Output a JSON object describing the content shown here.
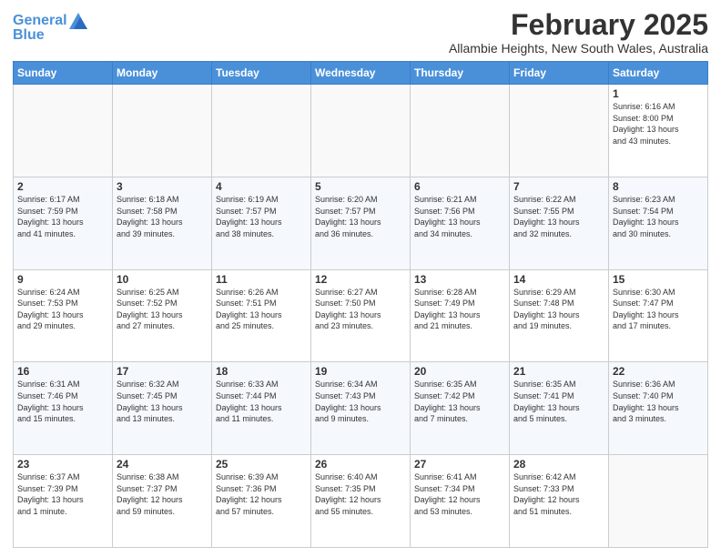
{
  "logo": {
    "line1": "General",
    "line2": "Blue"
  },
  "title": "February 2025",
  "location": "Allambie Heights, New South Wales, Australia",
  "headers": [
    "Sunday",
    "Monday",
    "Tuesday",
    "Wednesday",
    "Thursday",
    "Friday",
    "Saturday"
  ],
  "weeks": [
    [
      {
        "day": "",
        "info": ""
      },
      {
        "day": "",
        "info": ""
      },
      {
        "day": "",
        "info": ""
      },
      {
        "day": "",
        "info": ""
      },
      {
        "day": "",
        "info": ""
      },
      {
        "day": "",
        "info": ""
      },
      {
        "day": "1",
        "info": "Sunrise: 6:16 AM\nSunset: 8:00 PM\nDaylight: 13 hours\nand 43 minutes."
      }
    ],
    [
      {
        "day": "2",
        "info": "Sunrise: 6:17 AM\nSunset: 7:59 PM\nDaylight: 13 hours\nand 41 minutes."
      },
      {
        "day": "3",
        "info": "Sunrise: 6:18 AM\nSunset: 7:58 PM\nDaylight: 13 hours\nand 39 minutes."
      },
      {
        "day": "4",
        "info": "Sunrise: 6:19 AM\nSunset: 7:57 PM\nDaylight: 13 hours\nand 38 minutes."
      },
      {
        "day": "5",
        "info": "Sunrise: 6:20 AM\nSunset: 7:57 PM\nDaylight: 13 hours\nand 36 minutes."
      },
      {
        "day": "6",
        "info": "Sunrise: 6:21 AM\nSunset: 7:56 PM\nDaylight: 13 hours\nand 34 minutes."
      },
      {
        "day": "7",
        "info": "Sunrise: 6:22 AM\nSunset: 7:55 PM\nDaylight: 13 hours\nand 32 minutes."
      },
      {
        "day": "8",
        "info": "Sunrise: 6:23 AM\nSunset: 7:54 PM\nDaylight: 13 hours\nand 30 minutes."
      }
    ],
    [
      {
        "day": "9",
        "info": "Sunrise: 6:24 AM\nSunset: 7:53 PM\nDaylight: 13 hours\nand 29 minutes."
      },
      {
        "day": "10",
        "info": "Sunrise: 6:25 AM\nSunset: 7:52 PM\nDaylight: 13 hours\nand 27 minutes."
      },
      {
        "day": "11",
        "info": "Sunrise: 6:26 AM\nSunset: 7:51 PM\nDaylight: 13 hours\nand 25 minutes."
      },
      {
        "day": "12",
        "info": "Sunrise: 6:27 AM\nSunset: 7:50 PM\nDaylight: 13 hours\nand 23 minutes."
      },
      {
        "day": "13",
        "info": "Sunrise: 6:28 AM\nSunset: 7:49 PM\nDaylight: 13 hours\nand 21 minutes."
      },
      {
        "day": "14",
        "info": "Sunrise: 6:29 AM\nSunset: 7:48 PM\nDaylight: 13 hours\nand 19 minutes."
      },
      {
        "day": "15",
        "info": "Sunrise: 6:30 AM\nSunset: 7:47 PM\nDaylight: 13 hours\nand 17 minutes."
      }
    ],
    [
      {
        "day": "16",
        "info": "Sunrise: 6:31 AM\nSunset: 7:46 PM\nDaylight: 13 hours\nand 15 minutes."
      },
      {
        "day": "17",
        "info": "Sunrise: 6:32 AM\nSunset: 7:45 PM\nDaylight: 13 hours\nand 13 minutes."
      },
      {
        "day": "18",
        "info": "Sunrise: 6:33 AM\nSunset: 7:44 PM\nDaylight: 13 hours\nand 11 minutes."
      },
      {
        "day": "19",
        "info": "Sunrise: 6:34 AM\nSunset: 7:43 PM\nDaylight: 13 hours\nand 9 minutes."
      },
      {
        "day": "20",
        "info": "Sunrise: 6:35 AM\nSunset: 7:42 PM\nDaylight: 13 hours\nand 7 minutes."
      },
      {
        "day": "21",
        "info": "Sunrise: 6:35 AM\nSunset: 7:41 PM\nDaylight: 13 hours\nand 5 minutes."
      },
      {
        "day": "22",
        "info": "Sunrise: 6:36 AM\nSunset: 7:40 PM\nDaylight: 13 hours\nand 3 minutes."
      }
    ],
    [
      {
        "day": "23",
        "info": "Sunrise: 6:37 AM\nSunset: 7:39 PM\nDaylight: 13 hours\nand 1 minute."
      },
      {
        "day": "24",
        "info": "Sunrise: 6:38 AM\nSunset: 7:37 PM\nDaylight: 12 hours\nand 59 minutes."
      },
      {
        "day": "25",
        "info": "Sunrise: 6:39 AM\nSunset: 7:36 PM\nDaylight: 12 hours\nand 57 minutes."
      },
      {
        "day": "26",
        "info": "Sunrise: 6:40 AM\nSunset: 7:35 PM\nDaylight: 12 hours\nand 55 minutes."
      },
      {
        "day": "27",
        "info": "Sunrise: 6:41 AM\nSunset: 7:34 PM\nDaylight: 12 hours\nand 53 minutes."
      },
      {
        "day": "28",
        "info": "Sunrise: 6:42 AM\nSunset: 7:33 PM\nDaylight: 12 hours\nand 51 minutes."
      },
      {
        "day": "",
        "info": ""
      }
    ]
  ]
}
